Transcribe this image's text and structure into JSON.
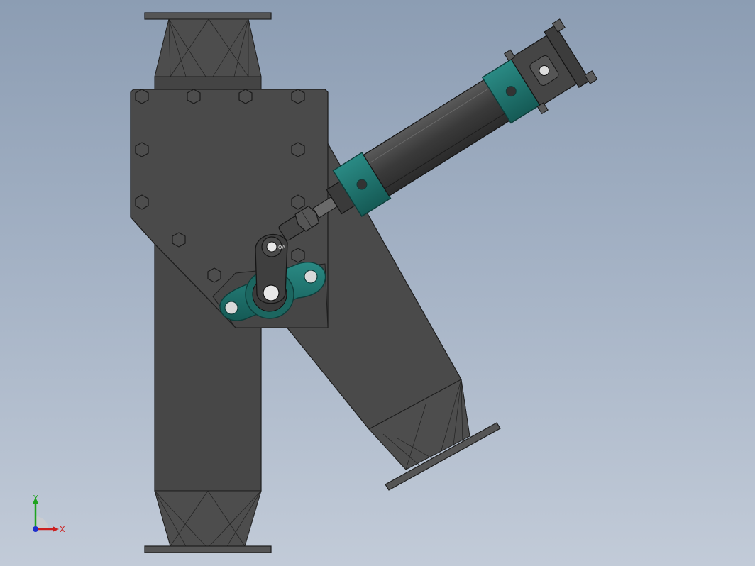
{
  "viewport": {
    "background_top": "#8c9db3",
    "background_bottom": "#c2cbd8"
  },
  "model": {
    "body_color": "#4a4a4a",
    "edge_color": "#1e1e1e",
    "accent_color": "#1f6b6b",
    "cylinder_color": "#3c3c3c",
    "rod_end_label": "OA"
  },
  "triad": {
    "x_label": "X",
    "y_label": "Y",
    "x_color": "#cc1f1f",
    "y_color": "#1fa31f",
    "z_color": "#1f2fcc"
  }
}
